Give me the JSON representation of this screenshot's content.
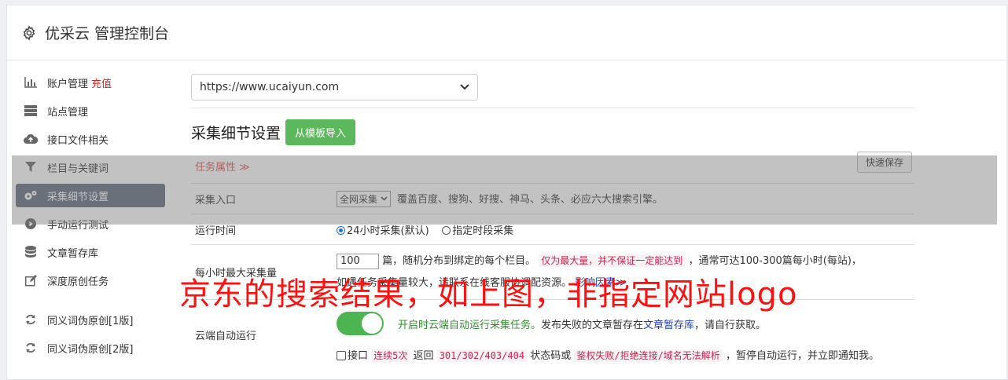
{
  "header": {
    "title": "优采云 管理控制台"
  },
  "sidebar": {
    "items": [
      {
        "label": "账户管理",
        "extra": "充值",
        "icon": "bar-chart-icon"
      },
      {
        "label": "站点管理",
        "icon": "server-icon"
      },
      {
        "label": "接口文件相关",
        "icon": "cloud-upload-icon"
      },
      {
        "label": "栏目与关键词",
        "icon": "filter-icon"
      },
      {
        "label": "采集细节设置",
        "icon": "cogs-icon",
        "active": true
      },
      {
        "label": "手动运行测试",
        "icon": "play-circle-icon"
      },
      {
        "label": "文章暂存库",
        "icon": "database-icon"
      },
      {
        "label": "深度原创任务",
        "icon": "edit-icon"
      },
      {
        "label": "同义词伪原创[1版]",
        "icon": "refresh-icon"
      },
      {
        "label": "同义词伪原创[2版]",
        "icon": "refresh-icon"
      }
    ]
  },
  "main": {
    "site_select": "https://www.ucaiyun.com",
    "section_title": "采集细节设置",
    "import_button": "从模板导入",
    "task_attr": "任务属性",
    "quick_save": "快速保存",
    "rows": {
      "entry": {
        "label": "采集入口",
        "select": "全网采集",
        "desc": "覆盖百度、搜狗、好搜、神马、头条、必应六大搜索引擎。"
      },
      "runtime": {
        "label": "运行时间",
        "opt1": "24小时采集(默认)",
        "opt2": "指定时段采集"
      },
      "maxcount": {
        "label": "每小时最大采集量",
        "value": "100",
        "text1": "篇，随机分布到绑定的每个栏目。",
        "warn": "仅为最大量，并不保证一定能达到",
        "text2": "，通常可达100-300篇每小时(每站)，",
        "text3": "如遇任务采集量较大，请联系在线客服协调配资源。",
        "link": "影响因素"
      },
      "cloud": {
        "label": "云端自动运行",
        "green": "开启时云端自动运行采集任务。",
        "text": "发布失败的文章暂存在",
        "link": "文章暂存库",
        "text_end": "，请自行获取。",
        "chk_label": "接口",
        "code1": "连续5次",
        "text2": "返回",
        "code2": "301/302/403/404",
        "text3": "状态码或",
        "code3": "鉴权失败/拒绝连接/域名无法解析",
        "text4": "，暂停自动运行，并立即通知我。"
      }
    }
  },
  "caption": "京东的搜索结果，如上图，非指定网站logo"
}
